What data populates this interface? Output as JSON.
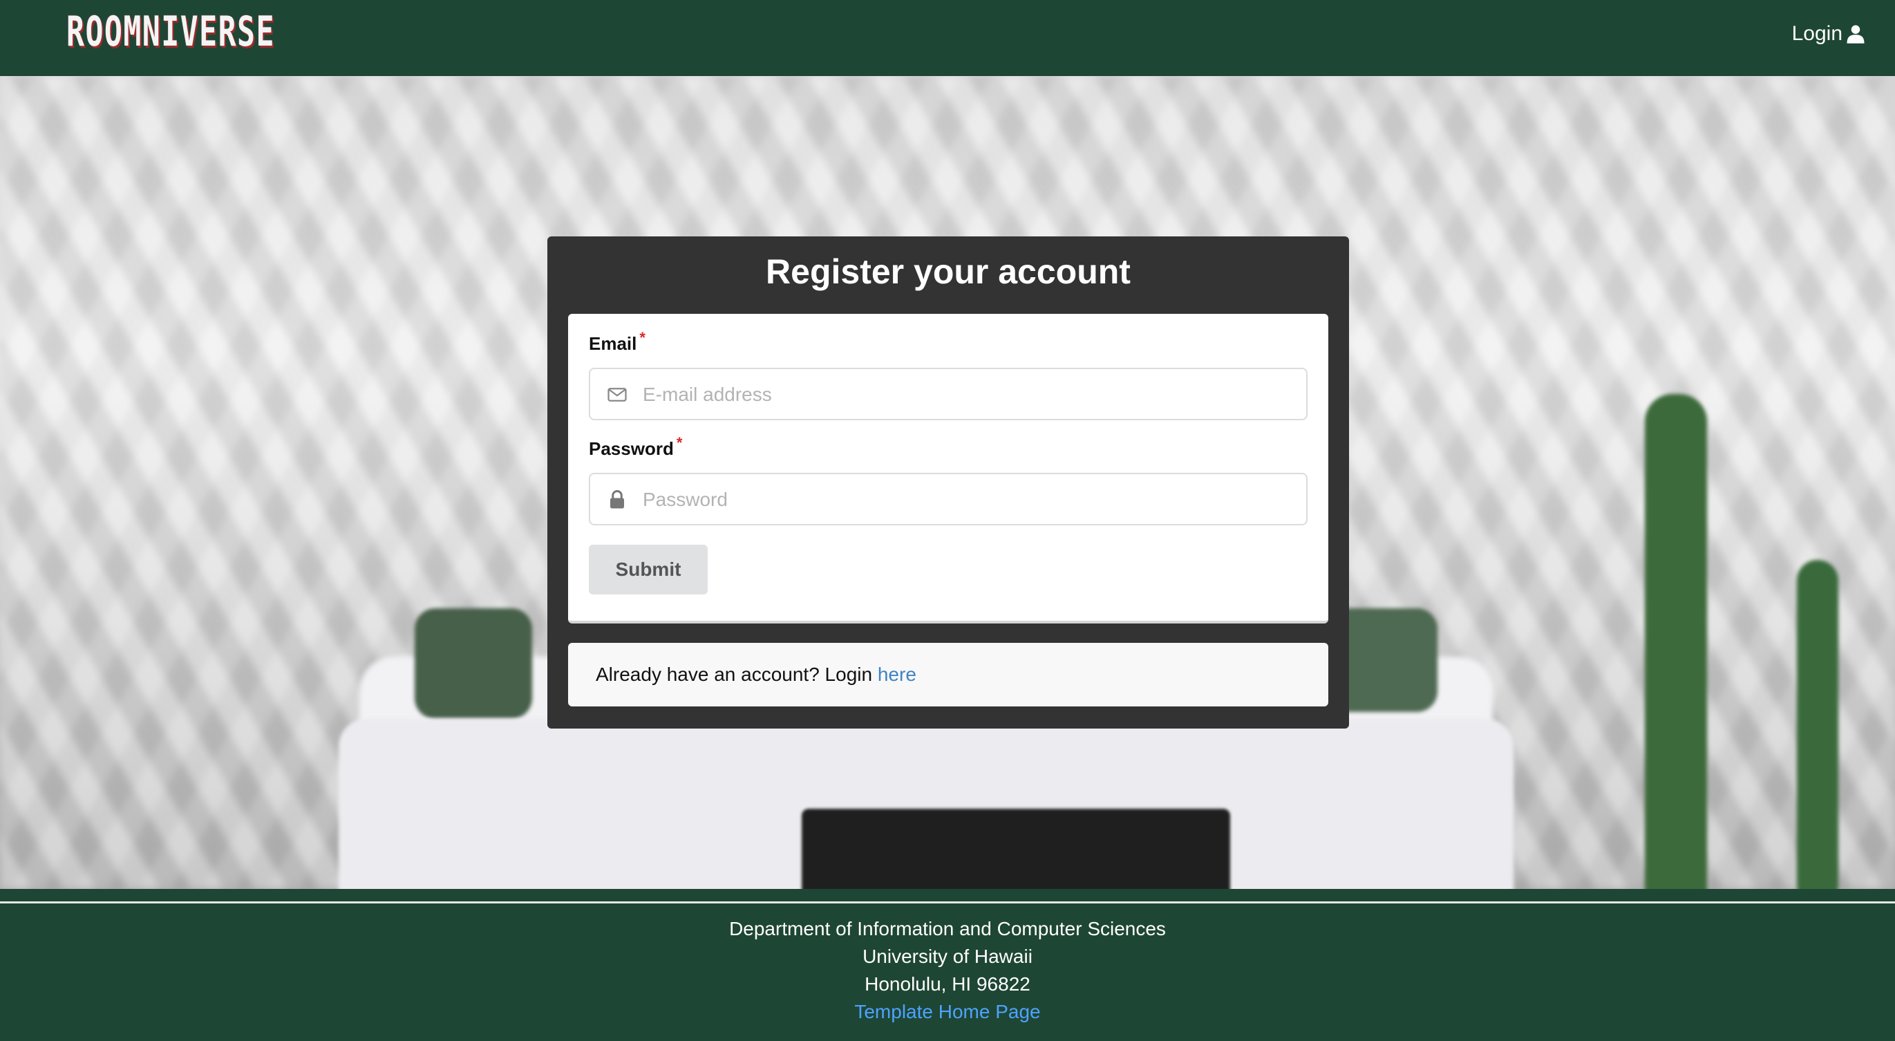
{
  "navbar": {
    "logo_text": "ROOMNIVERSE",
    "login_label": "Login"
  },
  "card": {
    "title": "Register your account",
    "email": {
      "label": "Email",
      "required_mark": "*",
      "placeholder": "E-mail address",
      "value": "",
      "icon": "envelope-icon"
    },
    "password": {
      "label": "Password",
      "required_mark": "*",
      "placeholder": "Password",
      "value": "",
      "icon": "lock-icon"
    },
    "submit_label": "Submit",
    "login_prompt": "Already have an account? Login",
    "login_link": "here"
  },
  "footer": {
    "line1": "Department of Information and Computer Sciences",
    "line2": "University of Hawaii",
    "line3": "Honolulu, HI 96822",
    "link": "Template Home Page"
  },
  "colors": {
    "brand_green": "#1e4634",
    "card_dark": "#333333",
    "link_blue": "#4183c4",
    "required_red": "#db2828"
  }
}
